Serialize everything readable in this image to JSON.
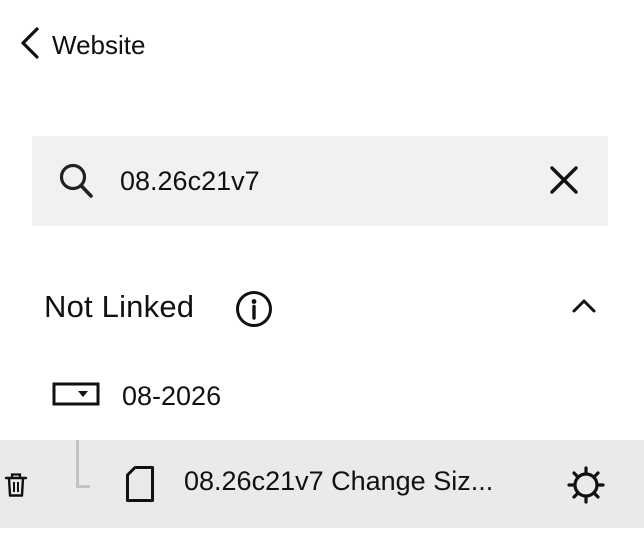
{
  "header": {
    "back_label": "Website"
  },
  "search": {
    "value": "08.26c21v7"
  },
  "section": {
    "title": "Not Linked"
  },
  "tree": {
    "folder": {
      "label": "08-2026"
    },
    "page": {
      "title": "08.26c21v7 Change Siz..."
    }
  },
  "icons": {
    "back": "chevron-left-icon",
    "search": "search-icon",
    "clear": "close-icon",
    "info": "info-icon",
    "collapse": "chevron-up-icon",
    "folder": "folder-dropdown-icon",
    "page": "page-icon",
    "trash": "trash-icon",
    "settings": "gear-icon"
  },
  "colors": {
    "search_bg": "#f1f1f1",
    "selected_row_bg": "#eaeaea",
    "tree_line": "#c4c4c4",
    "text": "#111111"
  }
}
